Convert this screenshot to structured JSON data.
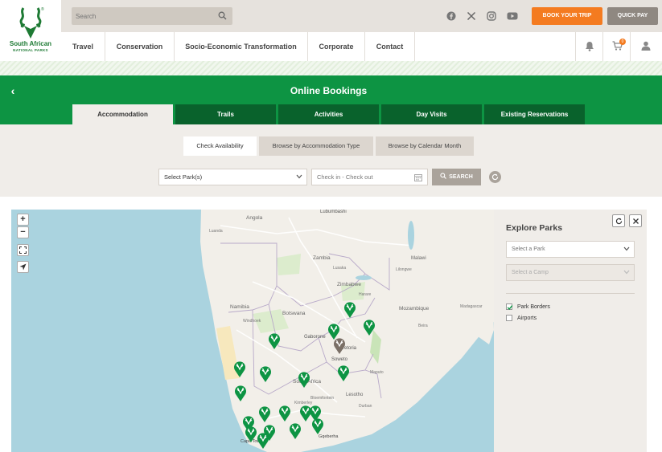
{
  "logo": {
    "line1": "South African",
    "line2": "NATIONAL PARKS",
    "mark": "®"
  },
  "search": {
    "placeholder": "Search",
    "value": ""
  },
  "header": {
    "book_label": "BOOK YOUR TRIP",
    "quick_pay_label": "QUICK PAY",
    "cart_count": "0"
  },
  "social": [
    "facebook-icon",
    "x-icon",
    "instagram-icon",
    "youtube-icon"
  ],
  "nav": {
    "items": [
      "Travel",
      "Conservation",
      "Socio-Economic Transformation",
      "Corporate",
      "Contact"
    ]
  },
  "bookings": {
    "title": "Online Bookings",
    "tabs": [
      "Accommodation",
      "Trails",
      "Activities",
      "Day Visits",
      "Existing Reservations"
    ],
    "active_tab": "Accommodation"
  },
  "filters": {
    "subtabs": [
      "Check Availability",
      "Browse by Accommodation Type",
      "Browse by Calendar Month"
    ],
    "active_subtab": "Check Availability",
    "park_select": "Select Park(s)",
    "date_placeholder": "Check in - Check out",
    "search_label": "SEARCH"
  },
  "map": {
    "labels": [
      "Lubumbashi",
      "Angola",
      "Zambia",
      "Zimbabwe",
      "Namibia",
      "Botswana",
      "Gaborone",
      "Pretoria",
      "Soweto",
      "South Africa",
      "Lesotho",
      "Cape Town",
      "Gqeberha",
      "Luanda",
      "Lusaka",
      "Harare",
      "Windhoek",
      "Maputo",
      "Durban",
      "Bloemfontein",
      "Kimberley",
      "Mozambique",
      "Malawi",
      "Lilongwe",
      "Beira",
      "Madagascar"
    ]
  },
  "explore": {
    "title": "Explore Parks",
    "park_select": "Select a Park",
    "camp_select": "Select a Camp",
    "layers": [
      {
        "label": "Park Borders",
        "checked": true
      },
      {
        "label": "Airports",
        "checked": false
      }
    ]
  },
  "colors": {
    "green": "#0d9443",
    "dark_green": "#09622c",
    "orange": "#f47b20",
    "beige": "#f0ede9"
  }
}
